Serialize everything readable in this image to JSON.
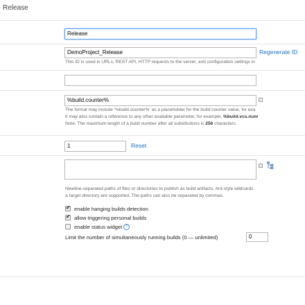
{
  "page_title": "Release",
  "build_name": {
    "value": "Release"
  },
  "build_id": {
    "value": "DemoProject_Release",
    "regenerate_label": "Regenerate ID",
    "hint": "This ID is used in URLs, REST API, HTTP requests to the server, and configuration settings in"
  },
  "description": {
    "value": ""
  },
  "build_number_format": {
    "value": "%build.counter%",
    "note_line1": "The format may include '%build.counter%' as a placeholder for the build counter value, for exa",
    "note_line2_prefix": "It may also contain a reference to any other available parameter, for example, ",
    "note_line2_bold": "%build.vcs.num",
    "note_line3_prefix": "Note: The maximum length of a build number after all substitutions is ",
    "note_line3_bold": "256",
    "note_line3_suffix": " characters."
  },
  "build_counter": {
    "value": "1",
    "reset_label": "Reset"
  },
  "artifact_paths": {
    "value": "",
    "note_line1": "Newline-separated paths of files or directories to publish as build artifacts. Ant-style wildcards",
    "note_line2": "a target directory are supported. The paths can also be separated by commas."
  },
  "options": [
    {
      "label": "enable hanging builds detection",
      "checked": true
    },
    {
      "label": "allow triggering personal builds",
      "checked": true
    },
    {
      "label": "enable status widget",
      "checked": false
    }
  ],
  "help_glyph": "?",
  "check_glyph": "✔",
  "limit": {
    "label": "Limit the number of simultaneously running builds (0 — unlimited)",
    "value": "0"
  }
}
